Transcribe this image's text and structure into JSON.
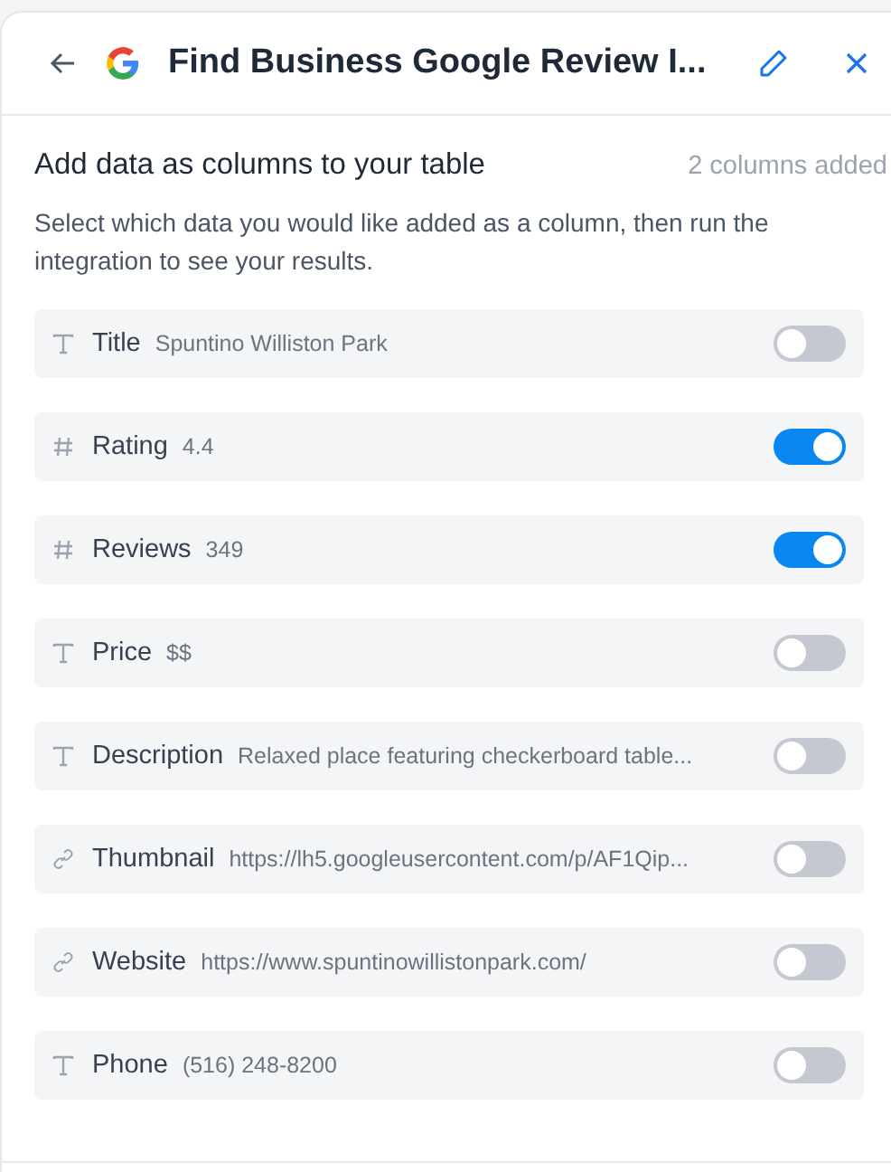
{
  "header": {
    "title": "Find Business Google Review I..."
  },
  "section": {
    "heading": "Add data as columns to your table",
    "count": "2 columns added",
    "description": "Select which data you would like added as a column, then run the integration to see your results."
  },
  "fields": [
    {
      "kind": "text",
      "label": "Title",
      "value": "Spuntino Williston Park",
      "on": false
    },
    {
      "kind": "number",
      "label": "Rating",
      "value": "4.4",
      "on": true
    },
    {
      "kind": "number",
      "label": "Reviews",
      "value": "349",
      "on": true
    },
    {
      "kind": "text",
      "label": "Price",
      "value": "$$",
      "on": false
    },
    {
      "kind": "text",
      "label": "Description",
      "value": "Relaxed place featuring checkerboard table...",
      "on": false
    },
    {
      "kind": "link",
      "label": "Thumbnail",
      "value": "https://lh5.googleusercontent.com/p/AF1Qip...",
      "on": false
    },
    {
      "kind": "link",
      "label": "Website",
      "value": "https://www.spuntinowillistonpark.com/",
      "on": false
    },
    {
      "kind": "text",
      "label": "Phone",
      "value": "(516) 248-8200",
      "on": false
    }
  ]
}
